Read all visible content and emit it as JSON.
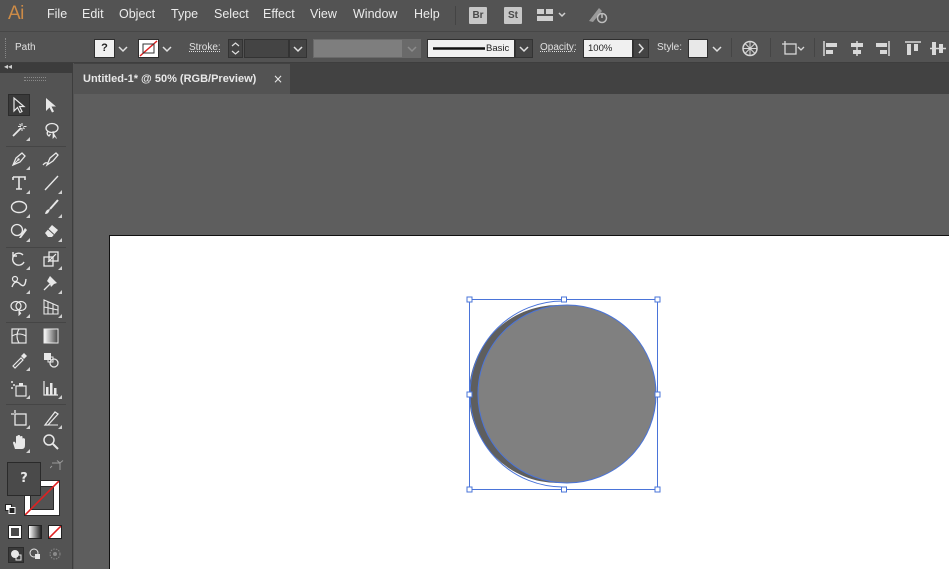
{
  "app": {
    "logo": "Ai"
  },
  "menu": [
    "File",
    "Edit",
    "Object",
    "Type",
    "Select",
    "Effect",
    "View",
    "Window",
    "Help"
  ],
  "menu_apps": {
    "bridge": "Br",
    "stock": "St"
  },
  "control": {
    "selection_type": "Path",
    "fill_label": "?",
    "stroke_label": "Stroke:",
    "brush_label": "Basic",
    "opacity_label": "Opacity:",
    "opacity_value": "100%",
    "style_label": "Style:"
  },
  "document": {
    "tab_title": "Untitled-1* @ 50% (RGB/Preview)",
    "close": "×"
  },
  "tools_panel": {
    "collapse": "◂◂",
    "fill_question": "?"
  },
  "colors": {
    "ui_bg": "#535353",
    "pasteboard": "#5e5e5e",
    "artboard": "#ffffff",
    "shape_fill": "#808080",
    "shadow_fill": "#5e5e5e",
    "selection": "#4a74d9",
    "logo": "#cc8b47"
  }
}
